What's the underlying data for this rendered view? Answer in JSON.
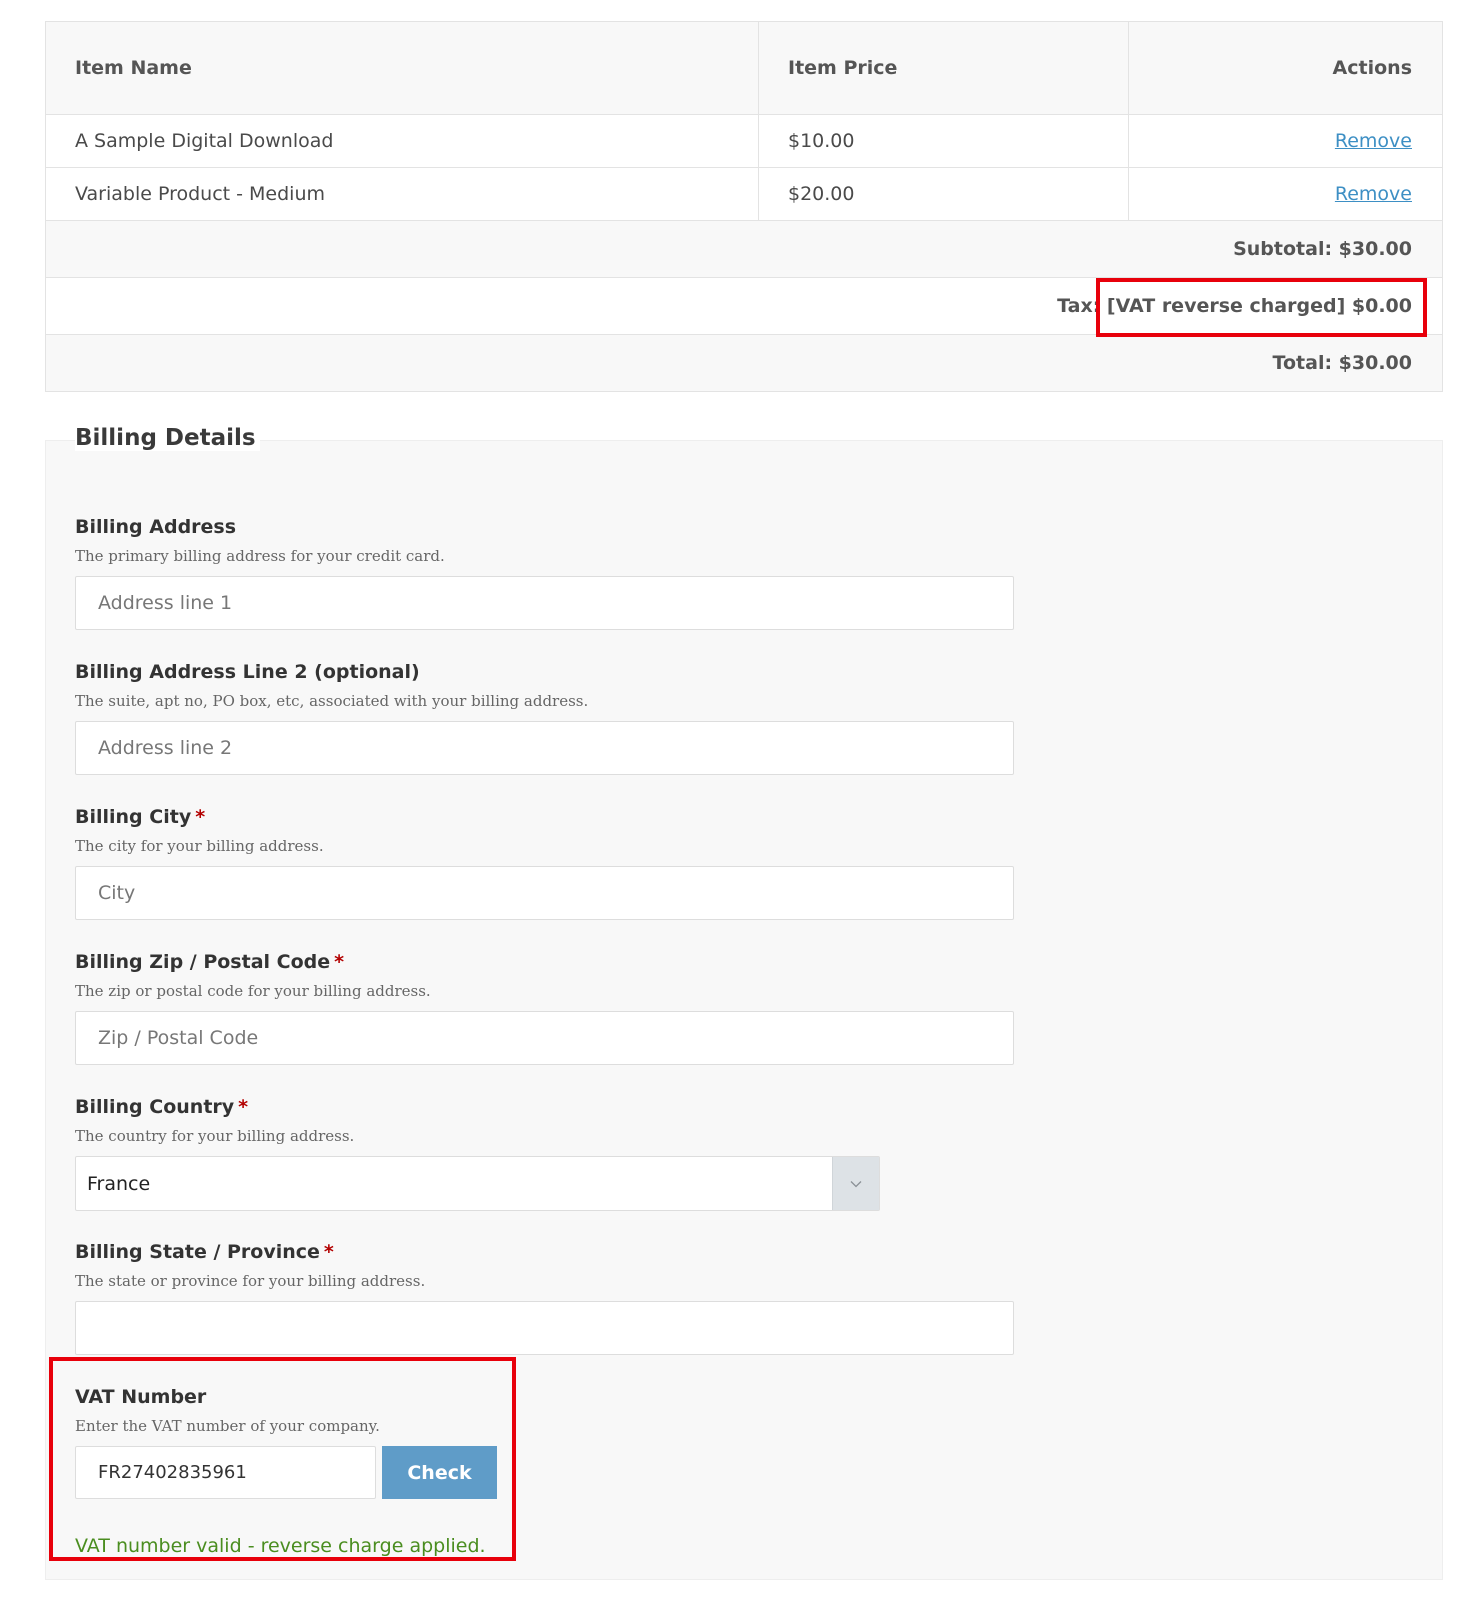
{
  "cart": {
    "headers": {
      "name": "Item Name",
      "price": "Item Price",
      "actions": "Actions"
    },
    "items": [
      {
        "name": "A Sample Digital Download",
        "price": "$10.00",
        "action": "Remove"
      },
      {
        "name": "Variable Product - Medium",
        "price": "$20.00",
        "action": "Remove"
      }
    ],
    "subtotal": "Subtotal: $30.00",
    "tax": "Tax: [VAT reverse charged] $0.00",
    "total": "Total: $30.00"
  },
  "billing": {
    "title": "Billing Details",
    "address1": {
      "label": "Billing Address",
      "description": "The primary billing address for your credit card.",
      "placeholder": "Address line 1",
      "value": ""
    },
    "address2": {
      "label": "Billing Address Line 2 (optional)",
      "description": "The suite, apt no, PO box, etc, associated with your billing address.",
      "placeholder": "Address line 2",
      "value": ""
    },
    "city": {
      "label": "Billing City",
      "required_mark": "*",
      "description": "The city for your billing address.",
      "placeholder": "City",
      "value": ""
    },
    "zip": {
      "label": "Billing Zip / Postal Code",
      "required_mark": "*",
      "description": "The zip or postal code for your billing address.",
      "placeholder": "Zip / Postal Code",
      "value": ""
    },
    "country": {
      "label": "Billing Country",
      "required_mark": "*",
      "description": "The country for your billing address.",
      "selected": "France"
    },
    "state": {
      "label": "Billing State / Province",
      "required_mark": "*",
      "description": "The state or province for your billing address.",
      "value": ""
    },
    "vat": {
      "label": "VAT Number",
      "description": "Enter the VAT number of your company.",
      "value": "FR27402835961",
      "button": "Check",
      "status": "VAT number valid - reverse charge applied."
    }
  },
  "colors": {
    "highlight_border": "#e8000b",
    "link": "#3d8fc4",
    "check_button": "#5f9cc8",
    "success_text": "#4a8d1f"
  },
  "icons": {
    "select_arrow": "chevron-down-icon"
  }
}
